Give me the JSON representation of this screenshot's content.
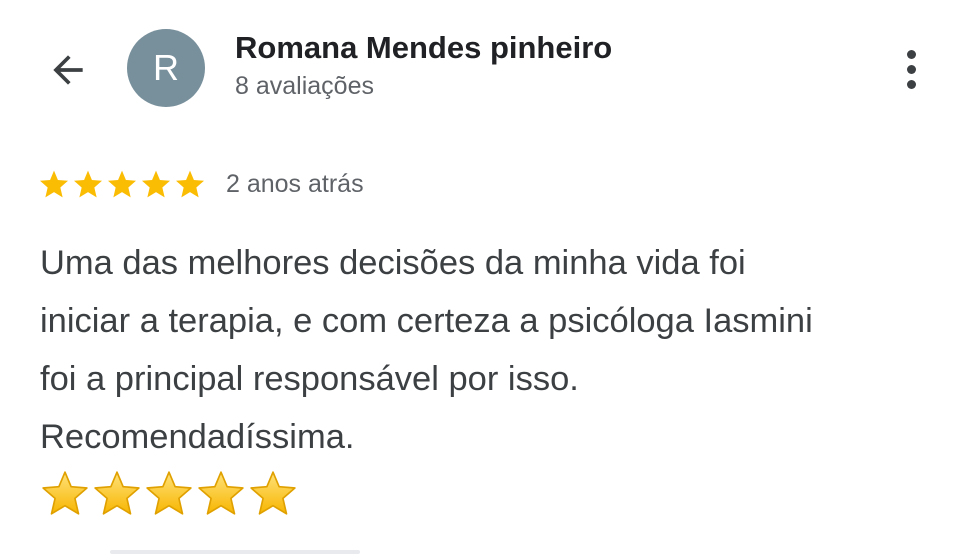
{
  "header": {
    "back_icon": "arrow-left-icon",
    "avatar_initial": "R",
    "avatar_color": "#78909c",
    "reviewer_name": "Romana Mendes pinheiro",
    "review_count": "8 avaliações",
    "more_icon": "more-vert-icon"
  },
  "review": {
    "rating": 5,
    "max_rating": 5,
    "star_color": "#fbbc04",
    "date": "2 anos atrás",
    "text_lines": [
      "Uma das melhores decisões da minha vida foi",
      "iniciar a terapia, e com certeza a psicóloga Iasmini",
      "foi a principal responsável por isso.",
      "Recomendadíssima."
    ],
    "emoji_stars": 5,
    "emoji_icon": "star-emoji-icon"
  }
}
